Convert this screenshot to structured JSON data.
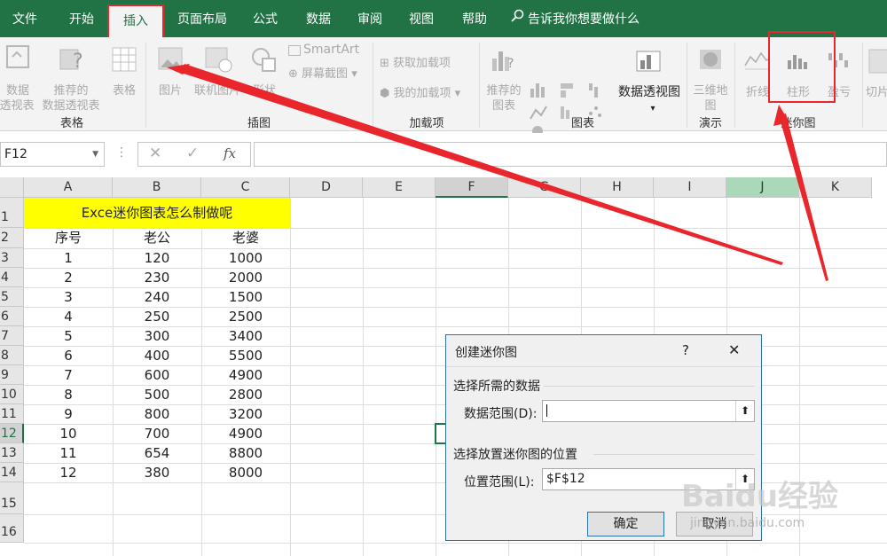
{
  "tabs": [
    {
      "label": "文件"
    },
    {
      "label": "开始"
    },
    {
      "label": "插入"
    },
    {
      "label": "页面布局"
    },
    {
      "label": "公式"
    },
    {
      "label": "数据"
    },
    {
      "label": "审阅"
    },
    {
      "label": "视图"
    },
    {
      "label": "帮助"
    }
  ],
  "tell_me": "告诉我你想要做什么",
  "ribbon": {
    "groups": {
      "tables": "表格",
      "illustrations": "插图",
      "addins": "加载项",
      "charts": "图表",
      "tours": "演示",
      "sparklines": "迷你图"
    },
    "buttons": {
      "pivot_line1": "数据",
      "pivot_line2": "透视表",
      "rec_pivot_line1": "推荐的",
      "rec_pivot_line2": "数据透视表",
      "table": "表格",
      "picture": "图片",
      "online_picture": "联机图片",
      "shapes": "形状",
      "smartart": "SmartArt",
      "screenshot": "屏幕截图",
      "get_addins": "获取加载项",
      "my_addins": "我的加载项",
      "rec_charts_line1": "推荐的",
      "rec_charts_line2": "图表",
      "pivot_chart": "数据透视图",
      "map3d_line1": "三维地",
      "map3d_line2": "图",
      "spark_line": "折线",
      "spark_column": "柱形",
      "spark_winloss": "盈亏",
      "slicer": "切片"
    }
  },
  "formula_bar": {
    "name_box": "F12",
    "fx": "fx",
    "formula": ""
  },
  "sheet": {
    "columns": [
      "A",
      "B",
      "C",
      "D",
      "E",
      "F",
      "G",
      "H",
      "I",
      "J",
      "K"
    ],
    "title": "Exce迷你图表怎么制做呢",
    "headers": [
      "序号",
      "老公",
      "老婆"
    ],
    "rows": [
      [
        "1",
        "120",
        "1000"
      ],
      [
        "2",
        "230",
        "2000"
      ],
      [
        "3",
        "240",
        "1500"
      ],
      [
        "4",
        "250",
        "2500"
      ],
      [
        "5",
        "300",
        "3400"
      ],
      [
        "6",
        "400",
        "5500"
      ],
      [
        "7",
        "600",
        "4900"
      ],
      [
        "8",
        "500",
        "2800"
      ],
      [
        "9",
        "800",
        "3200"
      ],
      [
        "10",
        "700",
        "4900"
      ],
      [
        "11",
        "654",
        "8800"
      ],
      [
        "12",
        "380",
        "8000"
      ]
    ],
    "row_numbers": [
      "1",
      "2",
      "3",
      "4",
      "5",
      "6",
      "7",
      "8",
      "9",
      "10",
      "11",
      "12",
      "13",
      "14",
      "15",
      "16"
    ]
  },
  "dialog": {
    "title": "创建迷你图",
    "help": "?",
    "close": "✕",
    "section_data": "选择所需的数据",
    "data_range_label": "数据范围(D):",
    "data_range_value": "",
    "section_location": "选择放置迷你图的位置",
    "location_label": "位置范围(L):",
    "location_value": "$F$12",
    "ok": "确定",
    "cancel": "取消"
  },
  "watermark": {
    "line1": "Baidu经验",
    "line2": "jingyan.baidu.com"
  },
  "colors": {
    "excel_green": "#217346",
    "highlight_red": "#e8262c",
    "title_yellow": "#ffff00"
  }
}
